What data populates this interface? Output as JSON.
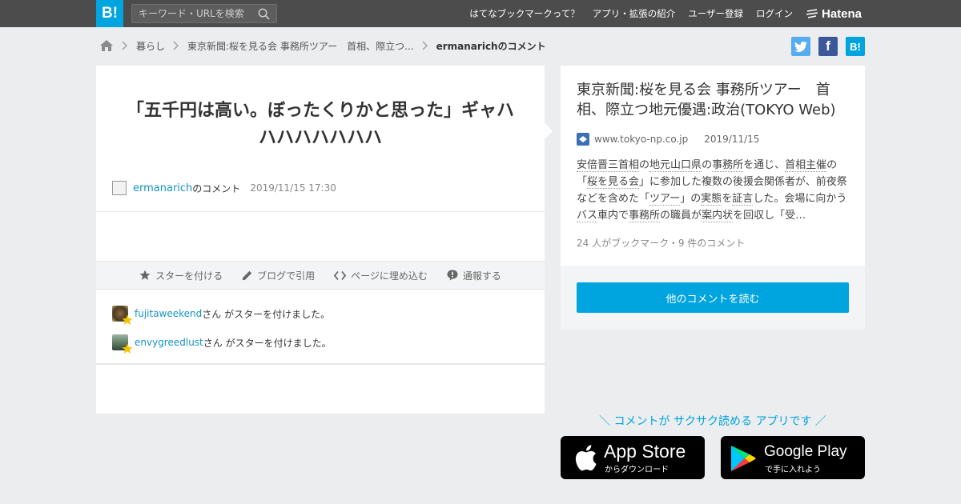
{
  "header": {
    "logo": "B!",
    "search_placeholder": "キーワード・URLを検索",
    "nav": [
      "はてなブックマークって？",
      "アプリ・拡張の紹介",
      "ユーザー登録",
      "ログイン"
    ],
    "brand": "Hatena"
  },
  "breadcrumb": {
    "items": [
      "暮らし",
      "東京新聞:桜を見る会 事務所ツアー　首相、際立つ..."
    ],
    "current": "ermanarichのコメント"
  },
  "share": {
    "facebook": "f",
    "hatebu": "B!"
  },
  "comment": {
    "text": "「五千円は高い。ぼったくりかと思った」ギャハハハハハハハハ",
    "user": "ermanarich",
    "suffix": "のコメント",
    "date": "2019/11/15 17:30"
  },
  "actions": [
    "スターを付ける",
    "ブログで引用",
    "ページに埋め込む",
    "通報する"
  ],
  "stars": [
    {
      "user": "fujitaweekend",
      "text": "さん がスターを付けました。"
    },
    {
      "user": "envygreedlust",
      "text": "さん がスターを付けました。"
    }
  ],
  "entry": {
    "title": "東京新聞:桜を見る会 事務所ツアー　首相、際立つ地元優遇:政治(TOKYO Web)",
    "domain": "www.tokyo-np.co.jp",
    "date": "2019/11/15",
    "summary_parts": [
      {
        "t": "安倍晋三首相",
        "k": true
      },
      {
        "t": "の",
        "k": false
      },
      {
        "t": "地元",
        "k": true
      },
      {
        "t": "山口県",
        "k": true
      },
      {
        "t": "の",
        "k": false
      },
      {
        "t": "事務所",
        "k": true
      },
      {
        "t": "を通じ、",
        "k": false
      },
      {
        "t": "首相主催",
        "k": true
      },
      {
        "t": "の「",
        "k": false
      },
      {
        "t": "桜を見る会",
        "k": true
      },
      {
        "t": "」に参加した複数の後援会関係者が、前夜祭などを含めた「",
        "k": false
      },
      {
        "t": "ツアー",
        "k": true
      },
      {
        "t": "」の",
        "k": false
      },
      {
        "t": "実態",
        "k": true
      },
      {
        "t": "を",
        "k": false
      },
      {
        "t": "証言",
        "k": true
      },
      {
        "t": "した。会場に向かう",
        "k": false
      },
      {
        "t": "バス",
        "k": true
      },
      {
        "t": "車内で",
        "k": false
      },
      {
        "t": "事務所",
        "k": true
      },
      {
        "t": "の職員が",
        "k": false
      },
      {
        "t": "案内状",
        "k": true
      },
      {
        "t": "を回収し「受…",
        "k": false
      }
    ],
    "count_text": "24 人がブックマーク・9 件のコメント",
    "read_button": "他のコメントを読む"
  },
  "promo": {
    "text": "＼ コメントが サクサク読める アプリです ／",
    "apple_name": "App Store",
    "apple_sub": "からダウンロード",
    "google_name": "Google Play",
    "google_sub": "で手に入れよう"
  },
  "colors": {
    "accent": "#00a4de",
    "topbar": "#4c4c4c",
    "link": "#1693c4",
    "star": "#f5c400"
  },
  "icons": [
    "search-icon",
    "home-icon",
    "twitter-icon",
    "star-icon",
    "pencil-icon",
    "code-icon",
    "alert-icon",
    "apple-icon",
    "google-play-icon"
  ]
}
